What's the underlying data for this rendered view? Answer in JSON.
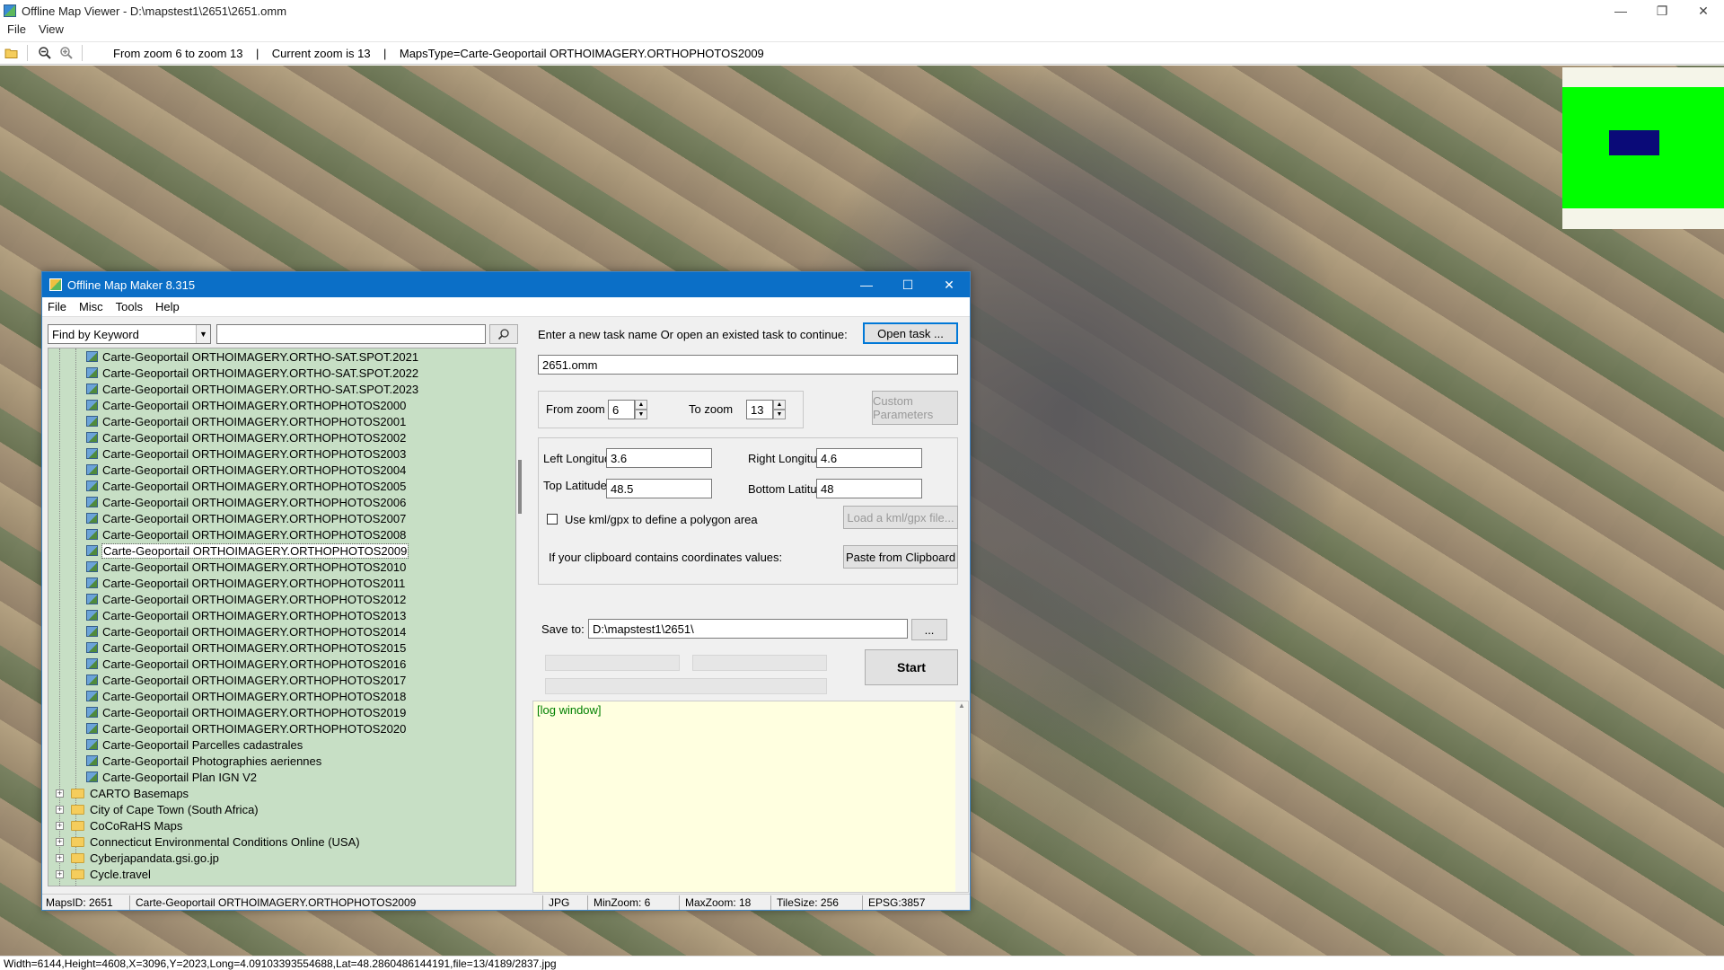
{
  "viewer": {
    "title": "Offline Map Viewer - D:\\mapstest1\\2651\\2651.omm",
    "menu": [
      "File",
      "View"
    ],
    "toolbar_info": "From zoom 6 to zoom 13    |    Current zoom is 13    |    MapsType=Carte-Geoportail ORTHOIMAGERY.ORTHOPHOTOS2009",
    "status": "Width=6144,Height=4608,X=3096,Y=2023,Long=4.09103393554688,Lat=48.2860486144191,file=13/4189/2837.jpg",
    "minimap_colors": {
      "background": "#00ff00",
      "viewport": "#0a0a78"
    }
  },
  "maker": {
    "title": "Offline Map Maker 8.315",
    "menu": [
      "File",
      "Misc",
      "Tools",
      "Help"
    ],
    "search": {
      "mode": "Find by Keyword",
      "query": "",
      "placeholder": ""
    },
    "tree_items": [
      "Carte-Geoportail ORTHOIMAGERY.ORTHO-SAT.SPOT.2021",
      "Carte-Geoportail ORTHOIMAGERY.ORTHO-SAT.SPOT.2022",
      "Carte-Geoportail ORTHOIMAGERY.ORTHO-SAT.SPOT.2023",
      "Carte-Geoportail ORTHOIMAGERY.ORTHOPHOTOS2000",
      "Carte-Geoportail ORTHOIMAGERY.ORTHOPHOTOS2001",
      "Carte-Geoportail ORTHOIMAGERY.ORTHOPHOTOS2002",
      "Carte-Geoportail ORTHOIMAGERY.ORTHOPHOTOS2003",
      "Carte-Geoportail ORTHOIMAGERY.ORTHOPHOTOS2004",
      "Carte-Geoportail ORTHOIMAGERY.ORTHOPHOTOS2005",
      "Carte-Geoportail ORTHOIMAGERY.ORTHOPHOTOS2006",
      "Carte-Geoportail ORTHOIMAGERY.ORTHOPHOTOS2007",
      "Carte-Geoportail ORTHOIMAGERY.ORTHOPHOTOS2008",
      "Carte-Geoportail ORTHOIMAGERY.ORTHOPHOTOS2009",
      "Carte-Geoportail ORTHOIMAGERY.ORTHOPHOTOS2010",
      "Carte-Geoportail ORTHOIMAGERY.ORTHOPHOTOS2011",
      "Carte-Geoportail ORTHOIMAGERY.ORTHOPHOTOS2012",
      "Carte-Geoportail ORTHOIMAGERY.ORTHOPHOTOS2013",
      "Carte-Geoportail ORTHOIMAGERY.ORTHOPHOTOS2014",
      "Carte-Geoportail ORTHOIMAGERY.ORTHOPHOTOS2015",
      "Carte-Geoportail ORTHOIMAGERY.ORTHOPHOTOS2016",
      "Carte-Geoportail ORTHOIMAGERY.ORTHOPHOTOS2017",
      "Carte-Geoportail ORTHOIMAGERY.ORTHOPHOTOS2018",
      "Carte-Geoportail ORTHOIMAGERY.ORTHOPHOTOS2019",
      "Carte-Geoportail ORTHOIMAGERY.ORTHOPHOTOS2020",
      "Carte-Geoportail Parcelles cadastrales",
      "Carte-Geoportail Photographies aeriennes",
      "Carte-Geoportail Plan IGN V2"
    ],
    "selected_item": "Carte-Geoportail ORTHOIMAGERY.ORTHOPHOTOS2009",
    "tree_folders": [
      "CARTO Basemaps",
      "City of Cape Town (South Africa)",
      "CoCoRaHS Maps",
      "Connecticut Environmental Conditions Online (USA)",
      "Cyberjapandata.gsi.go.jp",
      "Cycle.travel"
    ],
    "task_prompt": "Enter a new task name Or open an existed task to continue:",
    "open_task_label": "Open task ...",
    "task_name": "2651.omm",
    "from_zoom_label": "From zoom",
    "from_zoom": "6",
    "to_zoom_label": "To zoom",
    "to_zoom": "13",
    "custom_params_label": "Custom Parameters",
    "left_lon_label": "Left Longitude",
    "left_lon": "3.6",
    "right_lon_label": "Right Longitude",
    "right_lon": "4.6",
    "top_lat_label": "Top Latitude",
    "top_lat": "48.5",
    "bottom_lat_label": "Bottom Latitude",
    "bottom_lat": "48",
    "kml_checkbox_label": "Use kml/gpx to define a polygon area",
    "kml_checked": false,
    "load_kml_label": "Load a kml/gpx file...",
    "clipboard_prompt": "If your clipboard contains coordinates values:",
    "paste_label": "Paste from Clipboard",
    "save_to_label": "Save to:",
    "save_to": "D:\\mapstest1\\2651\\",
    "browse_label": "...",
    "start_label": "Start",
    "log_text": "[log window]",
    "status": {
      "maps_id": "MapsID: 2651",
      "map_name": "Carte-Geoportail ORTHOIMAGERY.ORTHOPHOTOS2009",
      "format": "JPG",
      "min_zoom": "MinZoom: 6",
      "max_zoom": "MaxZoom: 18",
      "tile_size": "TileSize: 256",
      "epsg": "EPSG:3857"
    }
  }
}
